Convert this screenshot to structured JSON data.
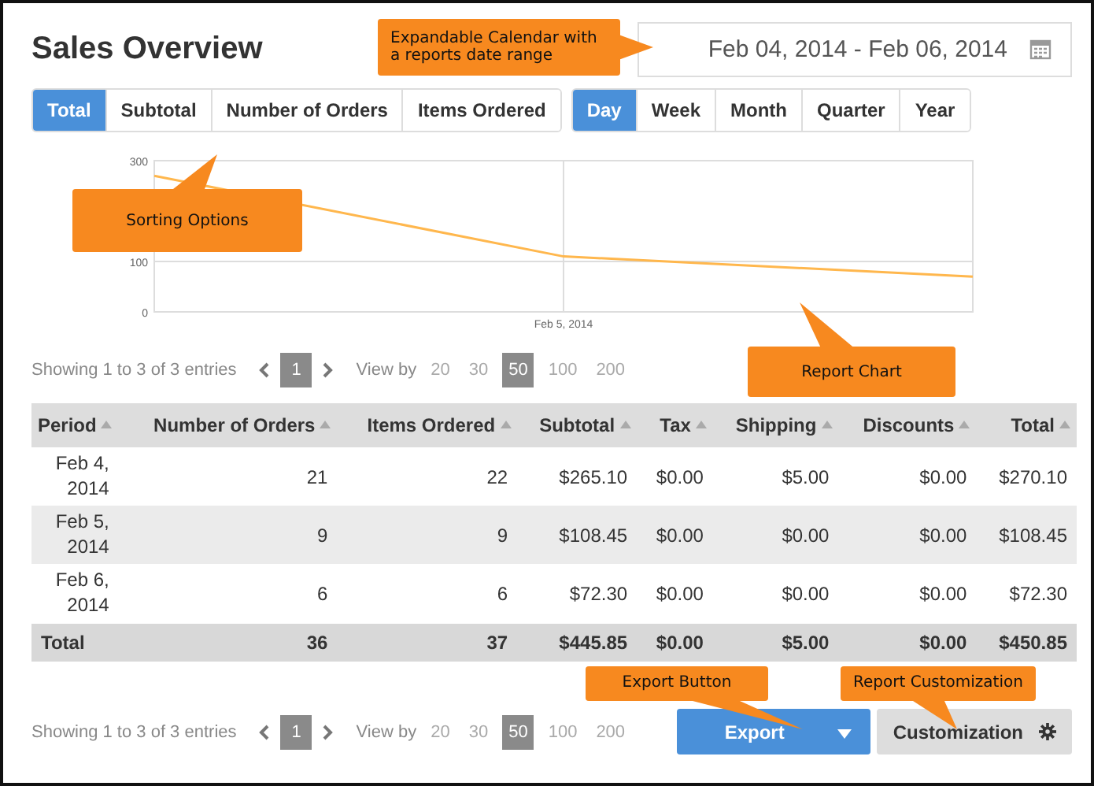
{
  "title": "Sales Overview",
  "date_range": {
    "value": "Feb 04, 2014 - Feb 06, 2014"
  },
  "metric_tabs": [
    {
      "label": "Total",
      "selected": true
    },
    {
      "label": "Subtotal",
      "selected": false
    },
    {
      "label": "Number of Orders",
      "selected": false
    },
    {
      "label": "Items Ordered",
      "selected": false
    }
  ],
  "period_tabs": [
    {
      "label": "Day",
      "selected": true
    },
    {
      "label": "Week",
      "selected": false
    },
    {
      "label": "Month",
      "selected": false
    },
    {
      "label": "Quarter",
      "selected": false
    },
    {
      "label": "Year",
      "selected": false
    }
  ],
  "chart": {
    "chart_data": {
      "type": "line",
      "ylim": [
        0,
        300
      ],
      "yticks": [
        {
          "value": 0,
          "label": "0"
        },
        {
          "value": 100,
          "label": "100"
        },
        {
          "value": 300,
          "label": "300"
        }
      ],
      "annotations": [
        "Feb 5, 2014"
      ],
      "series": [
        {
          "color": "#ffb74d",
          "values": [
            270,
            110,
            70
          ]
        }
      ]
    }
  },
  "pagination_top": {
    "summary": "Showing 1 to 3 of 3 entries",
    "pages": [
      {
        "label": "1",
        "selected": true
      }
    ],
    "view_by_label": "View by",
    "page_sizes": [
      {
        "label": "20",
        "selected": false
      },
      {
        "label": "30",
        "selected": false
      },
      {
        "label": "50",
        "selected": true
      },
      {
        "label": "100",
        "selected": false
      },
      {
        "label": "200",
        "selected": false
      }
    ]
  },
  "table": {
    "columns": [
      "Period",
      "Number of Orders",
      "Items Ordered",
      "Subtotal",
      "Tax",
      "Shipping",
      "Discounts",
      "Total"
    ],
    "rows": [
      [
        "Feb 4, 2014",
        "21",
        "22",
        "$265.10",
        "$0.00",
        "$5.00",
        "$0.00",
        "$270.10"
      ],
      [
        "Feb 5, 2014",
        "9",
        "9",
        "$108.45",
        "$0.00",
        "$0.00",
        "$0.00",
        "$108.45"
      ],
      [
        "Feb 6, 2014",
        "6",
        "6",
        "$72.30",
        "$0.00",
        "$0.00",
        "$0.00",
        "$72.30"
      ]
    ],
    "total_row": [
      "Total",
      "36",
      "37",
      "$445.85",
      "$0.00",
      "$5.00",
      "$0.00",
      "$450.85"
    ]
  },
  "pagination_bottom": {
    "summary": "Showing 1 to 3 of 3 entries",
    "pages": [
      {
        "label": "1",
        "selected": true
      }
    ],
    "view_by_label": "View by",
    "page_sizes": [
      {
        "label": "20",
        "selected": false
      },
      {
        "label": "30",
        "selected": false
      },
      {
        "label": "50",
        "selected": true
      },
      {
        "label": "100",
        "selected": false
      },
      {
        "label": "200",
        "selected": false
      }
    ]
  },
  "buttons": {
    "export": "Export",
    "customization": "Customization"
  },
  "annotations": {
    "calendar": "Expandable Calendar with a reports date range",
    "sorting": "Sorting Options",
    "chart": "Report Chart",
    "export": "Export Button",
    "customization": "Report Customization"
  }
}
